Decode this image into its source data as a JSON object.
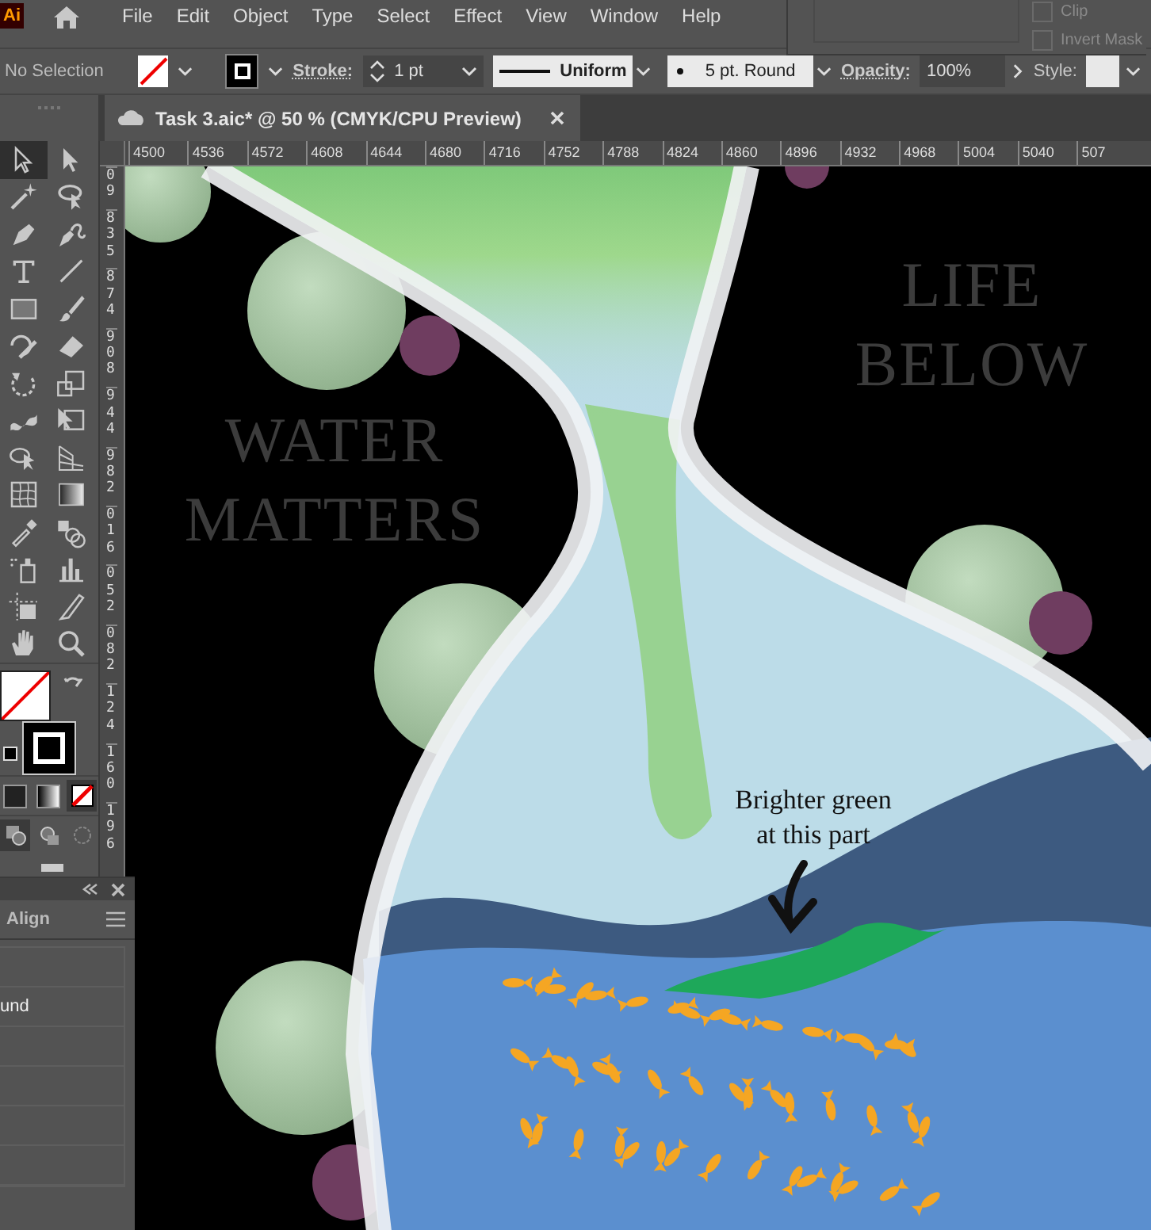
{
  "app": {
    "logo": "Ai"
  },
  "menu": [
    "File",
    "Edit",
    "Object",
    "Type",
    "Select",
    "Effect",
    "View",
    "Window",
    "Help"
  ],
  "mask_panel": {
    "options": [
      {
        "label": "Clip",
        "checked": false
      },
      {
        "label": "Invert Mask",
        "checked": false
      }
    ]
  },
  "control_bar": {
    "selection": "No Selection",
    "stroke_label": "Stroke:",
    "stroke_weight": "1 pt",
    "profile": "Uniform",
    "brush": "5 pt. Round",
    "opacity_label": "Opacity:",
    "opacity": "100%",
    "style_label": "Style:"
  },
  "document_tab": {
    "title": "Task 3.aic* @ 50 % (CMYK/CPU Preview)"
  },
  "rulers": {
    "horizontal": [
      "4500",
      "4536",
      "4572",
      "4608",
      "4644",
      "4680",
      "4716",
      "4752",
      "4788",
      "4824",
      "4860",
      "4896",
      "4932",
      "4968",
      "5004",
      "5040",
      "507"
    ],
    "vertical": [
      "09",
      "835",
      "874",
      "908",
      "944",
      "982",
      "016",
      "052",
      "082",
      "124",
      "160",
      "196"
    ]
  },
  "tools": [
    {
      "kind": "selection",
      "selected": true
    },
    {
      "kind": "direct",
      "selected": false
    },
    {
      "kind": "wand",
      "selected": false
    },
    {
      "kind": "lasso",
      "selected": false
    },
    {
      "kind": "pen",
      "selected": false
    },
    {
      "kind": "curvature",
      "selected": false
    },
    {
      "kind": "type",
      "selected": false
    },
    {
      "kind": "line",
      "selected": false
    },
    {
      "kind": "rectangle",
      "selected": false
    },
    {
      "kind": "paintbrush",
      "selected": false
    },
    {
      "kind": "shaper",
      "selected": false
    },
    {
      "kind": "eraser",
      "selected": false
    },
    {
      "kind": "rotate",
      "selected": false
    },
    {
      "kind": "scale",
      "selected": false
    },
    {
      "kind": "warp",
      "selected": false
    },
    {
      "kind": "transform",
      "selected": false
    },
    {
      "kind": "builder",
      "selected": false
    },
    {
      "kind": "perspective",
      "selected": false
    },
    {
      "kind": "mesh",
      "selected": false
    },
    {
      "kind": "gradient",
      "selected": false
    },
    {
      "kind": "eyedropper",
      "selected": false
    },
    {
      "kind": "blend",
      "selected": false
    },
    {
      "kind": "sprayer",
      "selected": false
    },
    {
      "kind": "graph",
      "selected": false
    },
    {
      "kind": "artboard",
      "selected": false
    },
    {
      "kind": "slice",
      "selected": false
    },
    {
      "kind": "hand",
      "selected": false
    },
    {
      "kind": "zoom",
      "selected": false
    }
  ],
  "color_modes": [
    {
      "kind": "color",
      "selected": false
    },
    {
      "kind": "gradient",
      "selected": false
    },
    {
      "kind": "none",
      "selected": true
    }
  ],
  "draw_modes": [
    {
      "kind": "normal",
      "selected": true
    },
    {
      "kind": "behind",
      "selected": false
    },
    {
      "kind": "inside",
      "selected": false
    }
  ],
  "align_panel": {
    "tab": "Align",
    "visible_text": "und"
  },
  "artwork": {
    "headings": [
      {
        "lines": [
          "WATER",
          "MATTERS"
        ]
      },
      {
        "lines": [
          "LIFE",
          "BELOW"
        ]
      }
    ],
    "note": {
      "lines": [
        "Brighter green",
        "at this part"
      ]
    }
  }
}
